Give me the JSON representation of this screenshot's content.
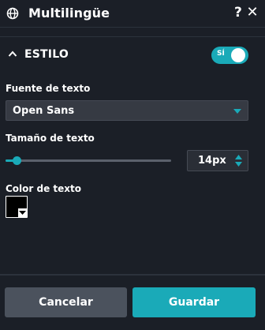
{
  "header": {
    "title": "Multilingüe",
    "help_label": "?",
    "close_label": "✕"
  },
  "section": {
    "title": "ESTILO",
    "toggle_label": "SÍ",
    "toggle_on": true
  },
  "font": {
    "label": "Fuente de texto",
    "value": "Open Sans"
  },
  "size": {
    "label": "Tamaño de texto",
    "value": "14px",
    "slider_fraction": 0.065
  },
  "color": {
    "label": "Color de texto",
    "value": "#000000"
  },
  "footer": {
    "cancel_label": "Cancelar",
    "save_label": "Guardar"
  },
  "colors": {
    "accent": "#1aaab8",
    "background": "#1b1f27",
    "cancel": "#4b525d"
  },
  "icons": [
    "globe-icon",
    "chevron-up-icon",
    "caret-down-icon",
    "stepper-up-icon",
    "stepper-down-icon",
    "color-caret-icon"
  ]
}
